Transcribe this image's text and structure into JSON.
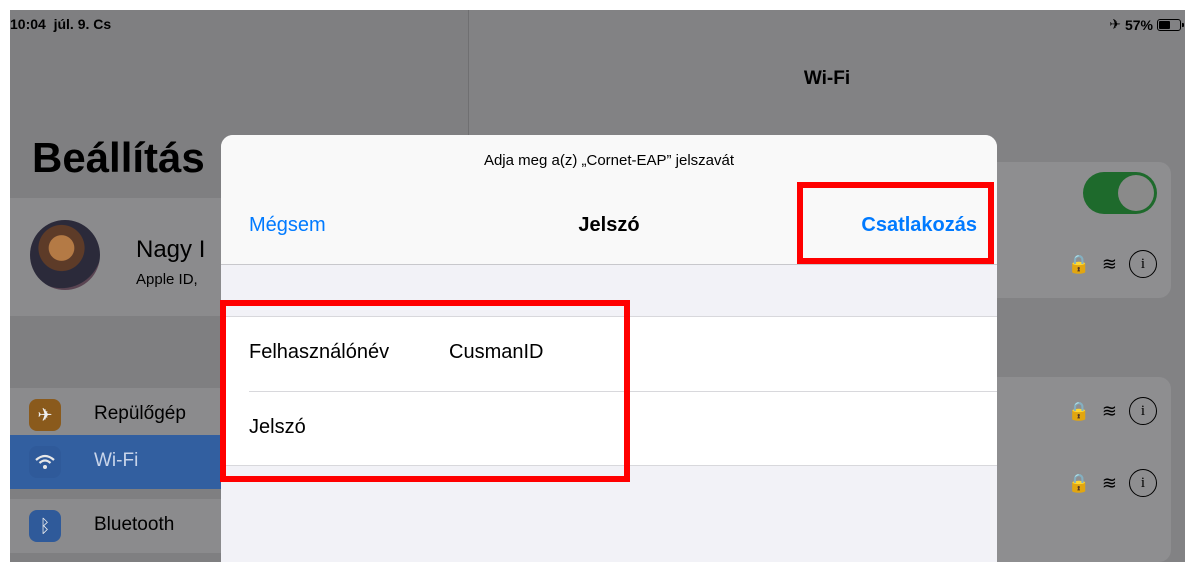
{
  "status_bar": {
    "time": "10:04",
    "date": "júl. 9. Cs",
    "battery_percent": "57%",
    "battery_level": 0.57,
    "airplane_icon": "airplane-icon"
  },
  "sidebar": {
    "title": "Beállítás",
    "profile": {
      "name": "Nagy I",
      "subtitle": "Apple ID,"
    },
    "items": [
      {
        "label": "Repülőgép",
        "icon": "airplane-icon",
        "color": "#8a5a1c"
      },
      {
        "label": "Wi-Fi",
        "icon": "wifi-icon",
        "color": "#2f5a9a",
        "selected": true
      },
      {
        "label": "Bluetooth",
        "icon": "bluetooth-icon",
        "color": "#2f5a9a"
      }
    ]
  },
  "detail": {
    "title": "Wi-Fi",
    "wifi_enabled": true
  },
  "dialog": {
    "prompt": "Adja meg a(z) „Cornet-EAP” jelszavát",
    "cancel_label": "Mégsem",
    "title": "Jelszó",
    "join_label": "Csatlakozás",
    "fields": {
      "username_label": "Felhasználónév",
      "username_value": "CusmanID",
      "password_label": "Jelszó",
      "password_value": ""
    }
  },
  "colors": {
    "accent": "#007aff",
    "highlight": "#ff0000",
    "toggle_on": "#34c759"
  }
}
